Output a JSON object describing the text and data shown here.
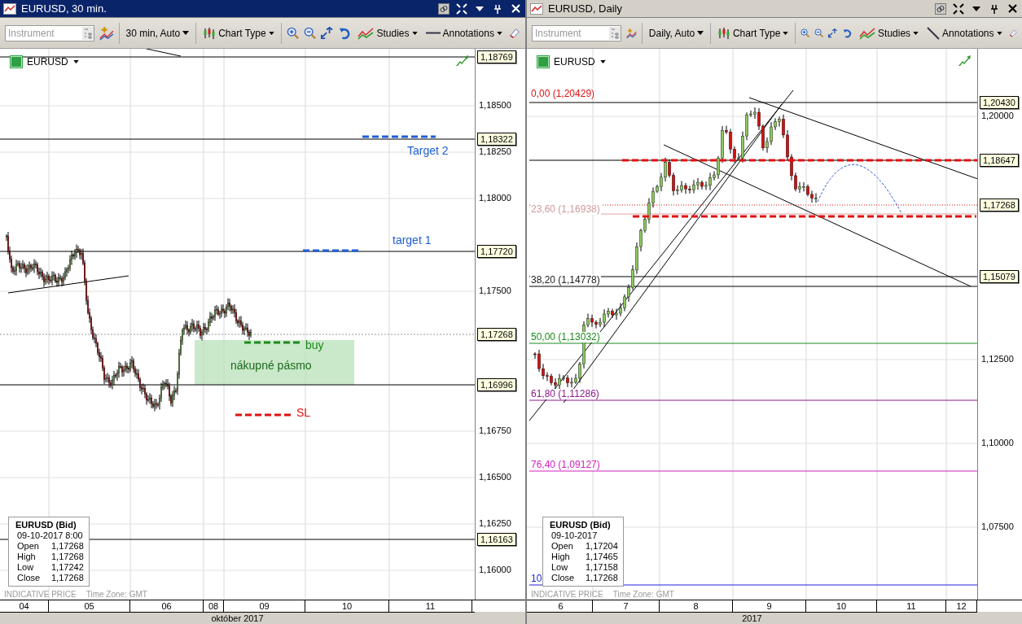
{
  "panels": [
    {
      "title": "EURUSD, 30 min.",
      "active": true,
      "toolbar": {
        "instrument_placeholder": "Instrument",
        "period": "30 min,  Auto",
        "chart_type": "Chart Type",
        "studies": "Studies",
        "annotations": "Annotations"
      },
      "symbol": "EURUSD",
      "axis_ticks": [
        "1,18500",
        "1,18250",
        "1,18000",
        "1,17500",
        "1,16750",
        "1,16500",
        "1,16250",
        "1,16000"
      ],
      "price_tags": [
        "1,18769",
        "1,18322",
        "1,17720",
        "1,17268",
        "1,16996",
        "1,16163"
      ],
      "labels": [
        {
          "text": "Target 2",
          "color": "#1f5fd8"
        },
        {
          "text": "target 1",
          "color": "#1f5fd8"
        },
        {
          "text": "buy",
          "color": "#1a8a1a"
        },
        {
          "text": "nákupné pásmo",
          "color": "#1a6a1a"
        },
        {
          "text": "SL",
          "color": "#e01010"
        }
      ],
      "info": {
        "title": "EURUSD (Bid)",
        "date": "09-10-2017 8:00",
        "rows": [
          {
            "name": "Open",
            "value": "1,17268"
          },
          {
            "name": "High",
            "value": "1,17268"
          },
          {
            "name": "Low",
            "value": "1,17242"
          },
          {
            "name": "Close",
            "value": "1,17268"
          }
        ]
      },
      "footer": {
        "price_type": "INDICATIVE PRICE",
        "time_zone": "Time Zone: GMT"
      },
      "time_labels": [
        "04",
        "05",
        "06",
        "08",
        "09",
        "10",
        "11"
      ],
      "period_label": "október 2017"
    },
    {
      "title": "EURUSD, Daily",
      "active": false,
      "toolbar": {
        "instrument_placeholder": "Instrument",
        "period": "Daily,  Auto",
        "chart_type": "Chart Type",
        "studies": "Studies",
        "annotations": "Annotations"
      },
      "symbol": "EURUSD",
      "axis_ticks": [
        "1,20000",
        "1,12500",
        "1,10000",
        "1,07500"
      ],
      "price_tags": [
        "1,20430",
        "1,18647",
        "1,17268",
        "1,15079"
      ],
      "labels": [
        {
          "text": "0,00 (1,20429)",
          "color": "#e01010"
        },
        {
          "text": "23,60 (1,16938)",
          "color": "#d09a9a"
        },
        {
          "text": "38,20 (1,14778)",
          "color": "#202020"
        },
        {
          "text": "50,00 (1,13032)",
          "color": "#1a8a1a"
        },
        {
          "text": "61,80 (1,11286)",
          "color": "#8a1a8a"
        },
        {
          "text": "76,40 (1,09127)",
          "color": "#d020c0"
        },
        {
          "text": "10",
          "color": "#2020e0"
        }
      ],
      "info": {
        "title": "EURUSD (Bid)",
        "date": "09-10-2017",
        "rows": [
          {
            "name": "Open",
            "value": "1,17204"
          },
          {
            "name": "High",
            "value": "1,17465"
          },
          {
            "name": "Low",
            "value": "1,17158"
          },
          {
            "name": "Close",
            "value": "1,17268"
          }
        ]
      },
      "footer": {
        "price_type": "INDICATIVE PRICE",
        "time_zone": "Time Zone: GMT"
      },
      "time_labels": [
        "6",
        "7",
        "8",
        "9",
        "10",
        "11",
        "12"
      ],
      "period_label": "2017"
    }
  ]
}
